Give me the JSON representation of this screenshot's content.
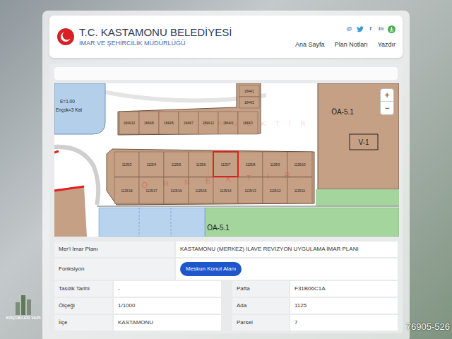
{
  "header": {
    "title": "T.C. KASTAMONU BELEDİYESİ",
    "subtitle": "İMAR VE ŞEHİRCİLİK MÜDÜRLÜĞÜ",
    "social": [
      {
        "kind": "text",
        "label": "@"
      },
      {
        "kind": "bird"
      },
      {
        "kind": "text",
        "label": "f"
      },
      {
        "kind": "text",
        "label": "in"
      },
      {
        "kind": "download"
      }
    ],
    "nav": [
      {
        "label": "Ana Sayfa"
      },
      {
        "label": "Plan Notları"
      },
      {
        "label": "Yazdır"
      }
    ]
  },
  "map": {
    "zoom": [
      "+",
      "−"
    ],
    "plan_note": [
      "E=1.00",
      "Ençok=3 Kat"
    ],
    "zones": [
      "ÖA-5.1",
      "V-1",
      "ÖA-5.1"
    ],
    "watermark": "ÖRNEKTİR",
    "upper_parcels": [
      "1844/10",
      "1844/8",
      "1844/6",
      "1844/7",
      "1844/12",
      "1844/4",
      "1844/3",
      "1844/1",
      "1844/2"
    ],
    "lower_top": [
      {
        "label": "1125/3",
        "selected": false
      },
      {
        "label": "1125/4",
        "selected": false
      },
      {
        "label": "1125/5",
        "selected": false
      },
      {
        "label": "1125/6",
        "selected": false
      },
      {
        "label": "1125/7",
        "selected": true
      },
      {
        "label": "1125/8",
        "selected": false
      },
      {
        "label": "1125/9",
        "selected": false
      },
      {
        "label": "1125/10",
        "selected": false
      }
    ],
    "lower_bottom": [
      {
        "label": "1125/18",
        "selected": false
      },
      {
        "label": "1125/17",
        "selected": false
      },
      {
        "label": "1125/16",
        "selected": false
      },
      {
        "label": "1125/15",
        "selected": false
      },
      {
        "label": "1125/14",
        "selected": false
      },
      {
        "label": "1125/13",
        "selected": false
      },
      {
        "label": "1125/12",
        "selected": false
      },
      {
        "label": "1125/11",
        "selected": false
      }
    ]
  },
  "info": {
    "plan": {
      "label": "Mer'i İmar Planı",
      "value": "KASTAMONU (MERKEZ) İLAVE REVİZYON UYGULAMA İMAR PLANI"
    },
    "function": {
      "label": "Fonksiyon",
      "value": "Meskun Konut Alanı"
    },
    "rows": [
      [
        {
          "label": "Tasdik Tarihi",
          "value": "-"
        },
        {
          "label": "Pafta",
          "value": "F31B06C1A"
        }
      ],
      [
        {
          "label": "Ölçeği",
          "value": "1/1000"
        },
        {
          "label": "Ada",
          "value": "1125"
        }
      ],
      [
        {
          "label": "İlçe",
          "value": "KASTAMONU"
        },
        {
          "label": "Parsel",
          "value": "7"
        }
      ]
    ]
  },
  "overlay": {
    "listing_id": "76905-526",
    "agency": "KÜÇÜKLER YAPI"
  }
}
